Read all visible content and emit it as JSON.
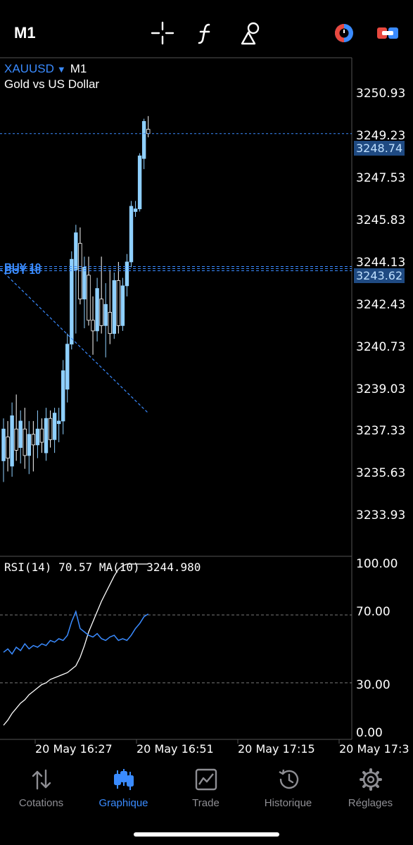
{
  "topbar": {
    "timeframe": "M1",
    "icons": [
      "crosshair-icon",
      "indicator-f-icon",
      "objects-icon",
      "one-click-trading-icon",
      "trade-icon"
    ]
  },
  "symbol": {
    "name": "XAUUSD",
    "timeframe": "M1",
    "description": "Gold vs US Dollar"
  },
  "price_axis": {
    "labels": [
      "3250.93",
      "3249.23",
      "3247.53",
      "3245.83",
      "3244.13",
      "3242.43",
      "3240.73",
      "3239.03",
      "3237.33",
      "3235.63",
      "3233.93"
    ],
    "current_price": "3248.74",
    "order_price": "3243.62"
  },
  "orders": {
    "label": "BUY 10"
  },
  "rsi": {
    "title": "RSI(14) 70.57 MA(10) 3244.980",
    "levels": [
      "100.00",
      "70.00",
      "30.00",
      "0.00"
    ]
  },
  "time_axis": {
    "labels": [
      "20 May 16:27",
      "20 May 16:51",
      "20 May 17:15",
      "20 May 17:3"
    ]
  },
  "nav": {
    "items": [
      {
        "label": "Cotations",
        "icon": "quotes-arrows-icon",
        "active": false
      },
      {
        "label": "Graphique",
        "icon": "chart-candles-icon",
        "active": true
      },
      {
        "label": "Trade",
        "icon": "trade-chart-icon",
        "active": false
      },
      {
        "label": "Historique",
        "icon": "history-icon",
        "active": false
      },
      {
        "label": "Réglages",
        "icon": "settings-gear-icon",
        "active": false
      }
    ]
  },
  "colors": {
    "accent": "#3a8bff",
    "bull_candle": "#8fd0ff",
    "bear_candle": "#ffffff",
    "background": "#000000"
  },
  "chart_data": {
    "type": "candlestick",
    "x_unit": "minute index",
    "candles": [
      {
        "o": 3236.4,
        "h": 3238.0,
        "l": 3235.6,
        "c": 3237.6
      },
      {
        "o": 3237.3,
        "h": 3237.9,
        "l": 3236.0,
        "c": 3236.5
      },
      {
        "o": 3236.2,
        "h": 3238.6,
        "l": 3235.8,
        "c": 3238.1
      },
      {
        "o": 3237.6,
        "h": 3238.9,
        "l": 3236.4,
        "c": 3236.8
      },
      {
        "o": 3236.9,
        "h": 3238.3,
        "l": 3236.3,
        "c": 3237.9
      },
      {
        "o": 3237.6,
        "h": 3238.4,
        "l": 3236.1,
        "c": 3236.6
      },
      {
        "o": 3236.6,
        "h": 3237.9,
        "l": 3235.9,
        "c": 3237.4
      },
      {
        "o": 3237.4,
        "h": 3237.9,
        "l": 3236.0,
        "c": 3237.0
      },
      {
        "o": 3237.0,
        "h": 3238.3,
        "l": 3236.5,
        "c": 3237.6
      },
      {
        "o": 3237.6,
        "h": 3238.0,
        "l": 3236.7,
        "c": 3237.1
      },
      {
        "o": 3236.7,
        "h": 3238.4,
        "l": 3236.4,
        "c": 3238.0
      },
      {
        "o": 3238.0,
        "h": 3238.3,
        "l": 3236.9,
        "c": 3237.2
      },
      {
        "o": 3237.2,
        "h": 3238.4,
        "l": 3236.7,
        "c": 3238.2
      },
      {
        "o": 3237.8,
        "h": 3238.4,
        "l": 3237.1,
        "c": 3237.9
      },
      {
        "o": 3237.9,
        "h": 3240.2,
        "l": 3237.4,
        "c": 3239.8
      },
      {
        "o": 3239.1,
        "h": 3241.2,
        "l": 3238.6,
        "c": 3240.8
      },
      {
        "o": 3240.8,
        "h": 3244.3,
        "l": 3240.6,
        "c": 3244.0
      },
      {
        "o": 3243.6,
        "h": 3245.3,
        "l": 3241.2,
        "c": 3245.0
      },
      {
        "o": 3244.6,
        "h": 3245.2,
        "l": 3242.3,
        "c": 3242.5
      },
      {
        "o": 3242.5,
        "h": 3244.1,
        "l": 3241.4,
        "c": 3243.7
      },
      {
        "o": 3243.4,
        "h": 3244.1,
        "l": 3241.5,
        "c": 3241.7
      },
      {
        "o": 3241.7,
        "h": 3242.6,
        "l": 3240.4,
        "c": 3241.3
      },
      {
        "o": 3241.3,
        "h": 3243.3,
        "l": 3240.9,
        "c": 3242.9
      },
      {
        "o": 3242.5,
        "h": 3244.1,
        "l": 3241.2,
        "c": 3241.5
      },
      {
        "o": 3241.5,
        "h": 3243.1,
        "l": 3240.3,
        "c": 3242.3
      },
      {
        "o": 3242.0,
        "h": 3243.6,
        "l": 3240.8,
        "c": 3241.2
      },
      {
        "o": 3241.2,
        "h": 3243.5,
        "l": 3241.0,
        "c": 3243.2
      },
      {
        "o": 3243.2,
        "h": 3243.9,
        "l": 3241.2,
        "c": 3241.5
      },
      {
        "o": 3241.5,
        "h": 3243.3,
        "l": 3241.3,
        "c": 3243.0
      },
      {
        "o": 3243.0,
        "h": 3244.2,
        "l": 3242.6,
        "c": 3243.9
      },
      {
        "o": 3243.9,
        "h": 3246.2,
        "l": 3243.7,
        "c": 3246.0
      },
      {
        "o": 3245.8,
        "h": 3246.2,
        "l": 3245.6,
        "c": 3245.9
      },
      {
        "o": 3245.9,
        "h": 3248.0,
        "l": 3245.8,
        "c": 3247.9
      },
      {
        "o": 3247.8,
        "h": 3249.3,
        "l": 3247.4,
        "c": 3249.2
      },
      {
        "o": 3248.9,
        "h": 3249.4,
        "l": 3248.6,
        "c": 3248.74
      }
    ],
    "price_axis_range": [
      3232.8,
      3251.6
    ],
    "current_price": 3248.74,
    "order_price": 3243.62,
    "trendline": [
      {
        "i": -0.7,
        "p": 3243.62
      },
      {
        "i": 34,
        "p": 3238.2
      }
    ],
    "rsi": {
      "range": [
        0,
        100
      ],
      "levels": [
        100,
        70,
        30,
        0
      ],
      "rsi_values": [
        48,
        50,
        47,
        51,
        49,
        53,
        50,
        52,
        51,
        53,
        52,
        55,
        54,
        56,
        55,
        58,
        66,
        72,
        62,
        60,
        58,
        57,
        59,
        56,
        55,
        57,
        58,
        55,
        56,
        55,
        58,
        62,
        65,
        69,
        70.57
      ],
      "ma_values": [
        5,
        8,
        12,
        15,
        18,
        20,
        23,
        25,
        27,
        29,
        30,
        32,
        33,
        34,
        35,
        36,
        38,
        40,
        45,
        52,
        60,
        66,
        72,
        78,
        83,
        88,
        93,
        97,
        99,
        100,
        100,
        100,
        100,
        100,
        100
      ]
    },
    "time_labels": [
      "20 May 16:27",
      "20 May 16:51",
      "20 May 17:15",
      "20 May 17:3"
    ]
  }
}
